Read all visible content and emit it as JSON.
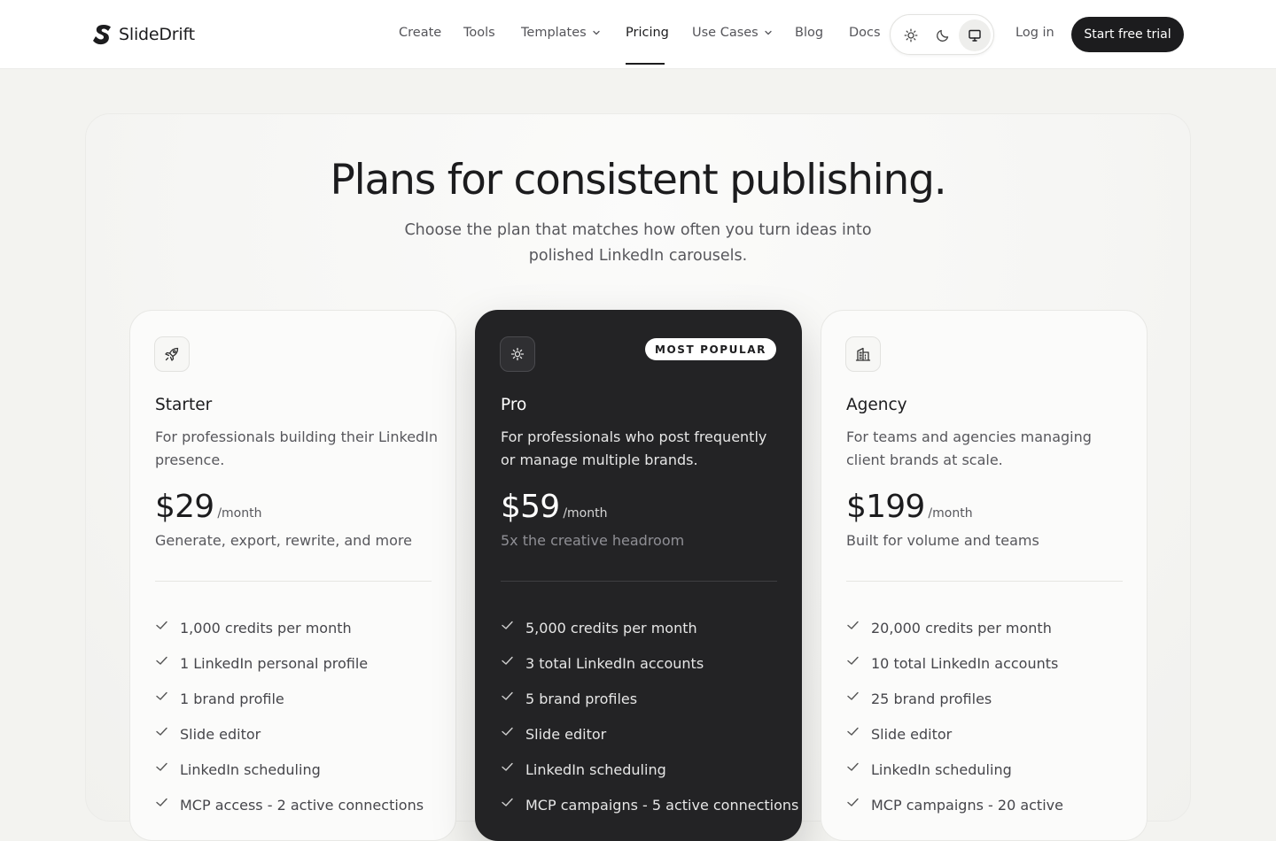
{
  "brand": {
    "name": "SlideDrift"
  },
  "nav": {
    "items": [
      {
        "label": "Create"
      },
      {
        "label": "Tools"
      },
      {
        "label": "Templates",
        "has_dropdown": true
      },
      {
        "label": "Pricing",
        "active": true
      },
      {
        "label": "Use Cases",
        "has_dropdown": true
      },
      {
        "label": "Blog"
      },
      {
        "label": "Docs"
      }
    ],
    "theme_options": [
      "light",
      "dark",
      "system"
    ],
    "theme_selected": "system",
    "login_label": "Log in",
    "cta_label": "Start free trial"
  },
  "hero": {
    "title": "Plans for consistent publishing.",
    "subtitle": "Choose the plan that matches how often you turn ideas into polished LinkedIn carousels."
  },
  "plans": [
    {
      "name": "Starter",
      "icon": "rocket-icon",
      "description": "For professionals building their LinkedIn presence.",
      "price": "$29",
      "period": "/month",
      "price_note": "Generate, export, rewrite, and more",
      "features": [
        "1,000 credits per month",
        "1 LinkedIn personal profile",
        "1 brand profile",
        "Slide editor",
        "LinkedIn scheduling",
        "MCP access - 2 active connections"
      ]
    },
    {
      "name": "Pro",
      "icon": "sparkle-icon",
      "badge": "MOST POPULAR",
      "description": "For professionals who post frequently or manage multiple brands.",
      "price": "$59",
      "period": "/month",
      "price_note": "5x the creative headroom",
      "features": [
        "5,000 credits per month",
        "3 total LinkedIn accounts",
        "5 brand profiles",
        "Slide editor",
        "LinkedIn scheduling",
        "MCP campaigns - 5 active connections"
      ]
    },
    {
      "name": "Agency",
      "icon": "building-icon",
      "description": "For teams and agencies managing client brands at scale.",
      "price": "$199",
      "period": "/month",
      "price_note": "Built for volume and teams",
      "features": [
        "20,000 credits per month",
        "10 total LinkedIn accounts",
        "25 brand profiles",
        "Slide editor",
        "LinkedIn scheduling",
        "MCP campaigns - 20 active"
      ]
    }
  ],
  "colors": {
    "page_bg": "#f3f3f0",
    "ink": "#1c1c1e",
    "featured_card_bg": "#232325",
    "muted_text": "#57575c"
  }
}
